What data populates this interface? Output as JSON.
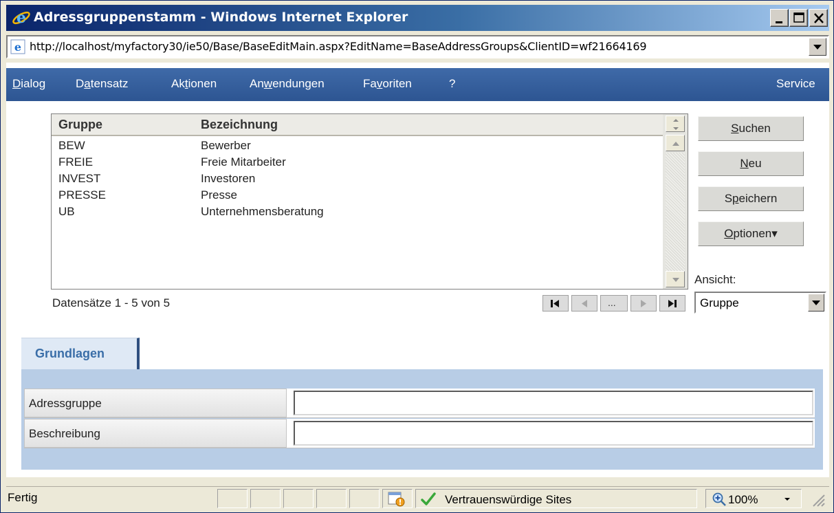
{
  "window": {
    "title": "Adressgruppenstamm - Windows Internet Explorer",
    "url": "http://localhost/myfactory30/ie50/Base/BaseEditMain.aspx?EditName=BaseAddressGroups&ClientID=wf21664169"
  },
  "menu": {
    "items": [
      {
        "label": "Dialog",
        "ul": "D",
        "rest": "ialog"
      },
      {
        "label": "Datensatz",
        "pre": "D",
        "ul": "a",
        "rest": "tensatz"
      },
      {
        "label": "Aktionen",
        "pre": "Ak",
        "ul": "t",
        "rest": "ionen"
      },
      {
        "label": "Anwendungen",
        "pre": "An",
        "ul": "w",
        "rest": "endungen"
      },
      {
        "label": "Favoriten",
        "pre": "Fa",
        "ul": "v",
        "rest": "oriten"
      },
      {
        "label": "?"
      }
    ],
    "service": "Service"
  },
  "grid": {
    "columns": [
      "Gruppe",
      "Bezeichnung"
    ],
    "rows": [
      {
        "gruppe": "BEW",
        "bezeichnung": "Bewerber"
      },
      {
        "gruppe": "FREIE",
        "bezeichnung": "Freie Mitarbeiter"
      },
      {
        "gruppe": "INVEST",
        "bezeichnung": "Investoren"
      },
      {
        "gruppe": "PRESSE",
        "bezeichnung": "Presse"
      },
      {
        "gruppe": "UB",
        "bezeichnung": "Unternehmensberatung"
      }
    ],
    "records_text": "Datensätze 1 - 5 von 5"
  },
  "pager": {
    "ellipsis": "..."
  },
  "buttons": {
    "suchen": {
      "label": "Suchen",
      "ul": "S",
      "rest": "uchen"
    },
    "neu": {
      "label": "Neu",
      "ul": "N",
      "rest": "eu"
    },
    "speichern": {
      "label": "Speichern",
      "pre": "S",
      "ul": "p",
      "rest": "eichern"
    },
    "optionen": {
      "label": "Optionen",
      "ul": "O",
      "rest": "ptionen",
      "arrow": "▾"
    }
  },
  "view": {
    "label": "Ansicht:",
    "selected": "Gruppe"
  },
  "tab": {
    "label": "Grundlagen"
  },
  "form": {
    "fields": [
      {
        "label": "Adressgruppe",
        "value": ""
      },
      {
        "label": "Beschreibung",
        "value": ""
      }
    ]
  },
  "status": {
    "text": "Fertig",
    "zone": "Vertrauenswürdige Sites",
    "zoom": "100%"
  },
  "icons": {
    "browser": "internet-explorer-icon",
    "trusted": "check-icon",
    "zoom": "magnifier-icon"
  }
}
